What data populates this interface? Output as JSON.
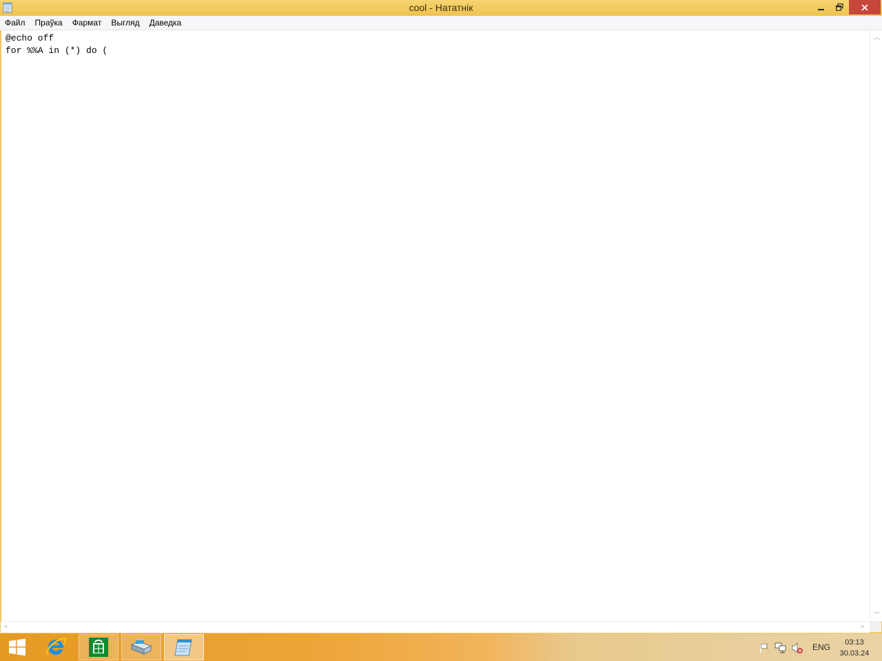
{
  "window": {
    "title": "cool - Нататнік",
    "app_icon": "notepad-icon",
    "controls": {
      "minimize": "minimize-icon",
      "maximize": "restore-icon",
      "close": "close-icon"
    }
  },
  "menu": {
    "items": [
      "Файл",
      "Праўка",
      "Фармат",
      "Выгляд",
      "Даведка"
    ]
  },
  "editor": {
    "content": "@echo off\nfor %%A in (*) do ("
  },
  "taskbar": {
    "items": [
      "windows-start-icon",
      "internet-explorer-icon",
      "store-icon",
      "file-explorer-icon",
      "notepad-icon"
    ],
    "tray": {
      "icons": [
        "flag-icon",
        "network-icon",
        "speaker-muted-icon"
      ],
      "language": "ENG",
      "time": "03:13",
      "date": "30.03.24"
    }
  },
  "colors": {
    "titlebar": "#f0c95f",
    "close_button": "#c7463b",
    "taskbar_accent": "#e59a24"
  }
}
